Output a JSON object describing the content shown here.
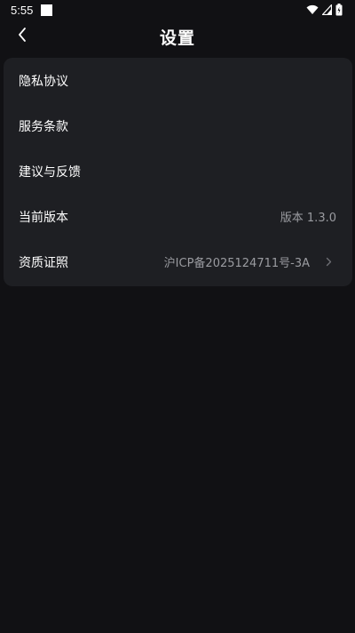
{
  "status_bar": {
    "time": "5:55",
    "icons": [
      "notification-square-icon",
      "wifi-icon",
      "signal-icon",
      "battery-icon"
    ]
  },
  "header": {
    "title": "设置",
    "back_icon": "chevron-left-icon"
  },
  "settings": {
    "items": [
      {
        "label": "隐私协议",
        "value": ""
      },
      {
        "label": "服务条款",
        "value": ""
      },
      {
        "label": "建议与反馈",
        "value": ""
      },
      {
        "label": "当前版本",
        "value": "版本 1.3.0"
      },
      {
        "label": "资质证照",
        "value": "沪ICP备2025124711号-3A"
      }
    ]
  },
  "colors": {
    "background": "#111114",
    "card": "#1e1f23",
    "text_primary": "#ffffff",
    "text_secondary": "#9a9ba0"
  }
}
